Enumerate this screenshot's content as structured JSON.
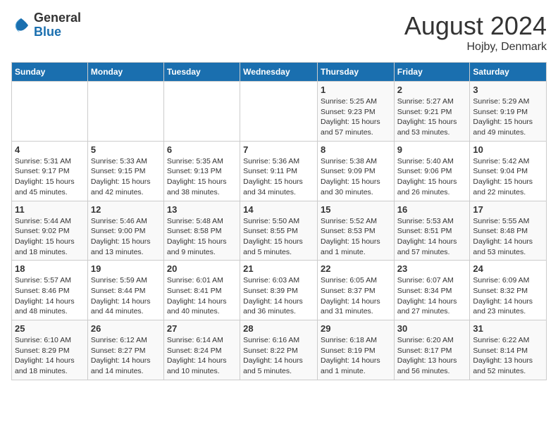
{
  "logo": {
    "general": "General",
    "blue": "Blue"
  },
  "title": "August 2024",
  "subtitle": "Hojby, Denmark",
  "weekdays": [
    "Sunday",
    "Monday",
    "Tuesday",
    "Wednesday",
    "Thursday",
    "Friday",
    "Saturday"
  ],
  "weeks": [
    [
      {
        "day": "",
        "info": ""
      },
      {
        "day": "",
        "info": ""
      },
      {
        "day": "",
        "info": ""
      },
      {
        "day": "",
        "info": ""
      },
      {
        "day": "1",
        "info": "Sunrise: 5:25 AM\nSunset: 9:23 PM\nDaylight: 15 hours\nand 57 minutes."
      },
      {
        "day": "2",
        "info": "Sunrise: 5:27 AM\nSunset: 9:21 PM\nDaylight: 15 hours\nand 53 minutes."
      },
      {
        "day": "3",
        "info": "Sunrise: 5:29 AM\nSunset: 9:19 PM\nDaylight: 15 hours\nand 49 minutes."
      }
    ],
    [
      {
        "day": "4",
        "info": "Sunrise: 5:31 AM\nSunset: 9:17 PM\nDaylight: 15 hours\nand 45 minutes."
      },
      {
        "day": "5",
        "info": "Sunrise: 5:33 AM\nSunset: 9:15 PM\nDaylight: 15 hours\nand 42 minutes."
      },
      {
        "day": "6",
        "info": "Sunrise: 5:35 AM\nSunset: 9:13 PM\nDaylight: 15 hours\nand 38 minutes."
      },
      {
        "day": "7",
        "info": "Sunrise: 5:36 AM\nSunset: 9:11 PM\nDaylight: 15 hours\nand 34 minutes."
      },
      {
        "day": "8",
        "info": "Sunrise: 5:38 AM\nSunset: 9:09 PM\nDaylight: 15 hours\nand 30 minutes."
      },
      {
        "day": "9",
        "info": "Sunrise: 5:40 AM\nSunset: 9:06 PM\nDaylight: 15 hours\nand 26 minutes."
      },
      {
        "day": "10",
        "info": "Sunrise: 5:42 AM\nSunset: 9:04 PM\nDaylight: 15 hours\nand 22 minutes."
      }
    ],
    [
      {
        "day": "11",
        "info": "Sunrise: 5:44 AM\nSunset: 9:02 PM\nDaylight: 15 hours\nand 18 minutes."
      },
      {
        "day": "12",
        "info": "Sunrise: 5:46 AM\nSunset: 9:00 PM\nDaylight: 15 hours\nand 13 minutes."
      },
      {
        "day": "13",
        "info": "Sunrise: 5:48 AM\nSunset: 8:58 PM\nDaylight: 15 hours\nand 9 minutes."
      },
      {
        "day": "14",
        "info": "Sunrise: 5:50 AM\nSunset: 8:55 PM\nDaylight: 15 hours\nand 5 minutes."
      },
      {
        "day": "15",
        "info": "Sunrise: 5:52 AM\nSunset: 8:53 PM\nDaylight: 15 hours\nand 1 minute."
      },
      {
        "day": "16",
        "info": "Sunrise: 5:53 AM\nSunset: 8:51 PM\nDaylight: 14 hours\nand 57 minutes."
      },
      {
        "day": "17",
        "info": "Sunrise: 5:55 AM\nSunset: 8:48 PM\nDaylight: 14 hours\nand 53 minutes."
      }
    ],
    [
      {
        "day": "18",
        "info": "Sunrise: 5:57 AM\nSunset: 8:46 PM\nDaylight: 14 hours\nand 48 minutes."
      },
      {
        "day": "19",
        "info": "Sunrise: 5:59 AM\nSunset: 8:44 PM\nDaylight: 14 hours\nand 44 minutes."
      },
      {
        "day": "20",
        "info": "Sunrise: 6:01 AM\nSunset: 8:41 PM\nDaylight: 14 hours\nand 40 minutes."
      },
      {
        "day": "21",
        "info": "Sunrise: 6:03 AM\nSunset: 8:39 PM\nDaylight: 14 hours\nand 36 minutes."
      },
      {
        "day": "22",
        "info": "Sunrise: 6:05 AM\nSunset: 8:37 PM\nDaylight: 14 hours\nand 31 minutes."
      },
      {
        "day": "23",
        "info": "Sunrise: 6:07 AM\nSunset: 8:34 PM\nDaylight: 14 hours\nand 27 minutes."
      },
      {
        "day": "24",
        "info": "Sunrise: 6:09 AM\nSunset: 8:32 PM\nDaylight: 14 hours\nand 23 minutes."
      }
    ],
    [
      {
        "day": "25",
        "info": "Sunrise: 6:10 AM\nSunset: 8:29 PM\nDaylight: 14 hours\nand 18 minutes."
      },
      {
        "day": "26",
        "info": "Sunrise: 6:12 AM\nSunset: 8:27 PM\nDaylight: 14 hours\nand 14 minutes."
      },
      {
        "day": "27",
        "info": "Sunrise: 6:14 AM\nSunset: 8:24 PM\nDaylight: 14 hours\nand 10 minutes."
      },
      {
        "day": "28",
        "info": "Sunrise: 6:16 AM\nSunset: 8:22 PM\nDaylight: 14 hours\nand 5 minutes."
      },
      {
        "day": "29",
        "info": "Sunrise: 6:18 AM\nSunset: 8:19 PM\nDaylight: 14 hours\nand 1 minute."
      },
      {
        "day": "30",
        "info": "Sunrise: 6:20 AM\nSunset: 8:17 PM\nDaylight: 13 hours\nand 56 minutes."
      },
      {
        "day": "31",
        "info": "Sunrise: 6:22 AM\nSunset: 8:14 PM\nDaylight: 13 hours\nand 52 minutes."
      }
    ]
  ]
}
